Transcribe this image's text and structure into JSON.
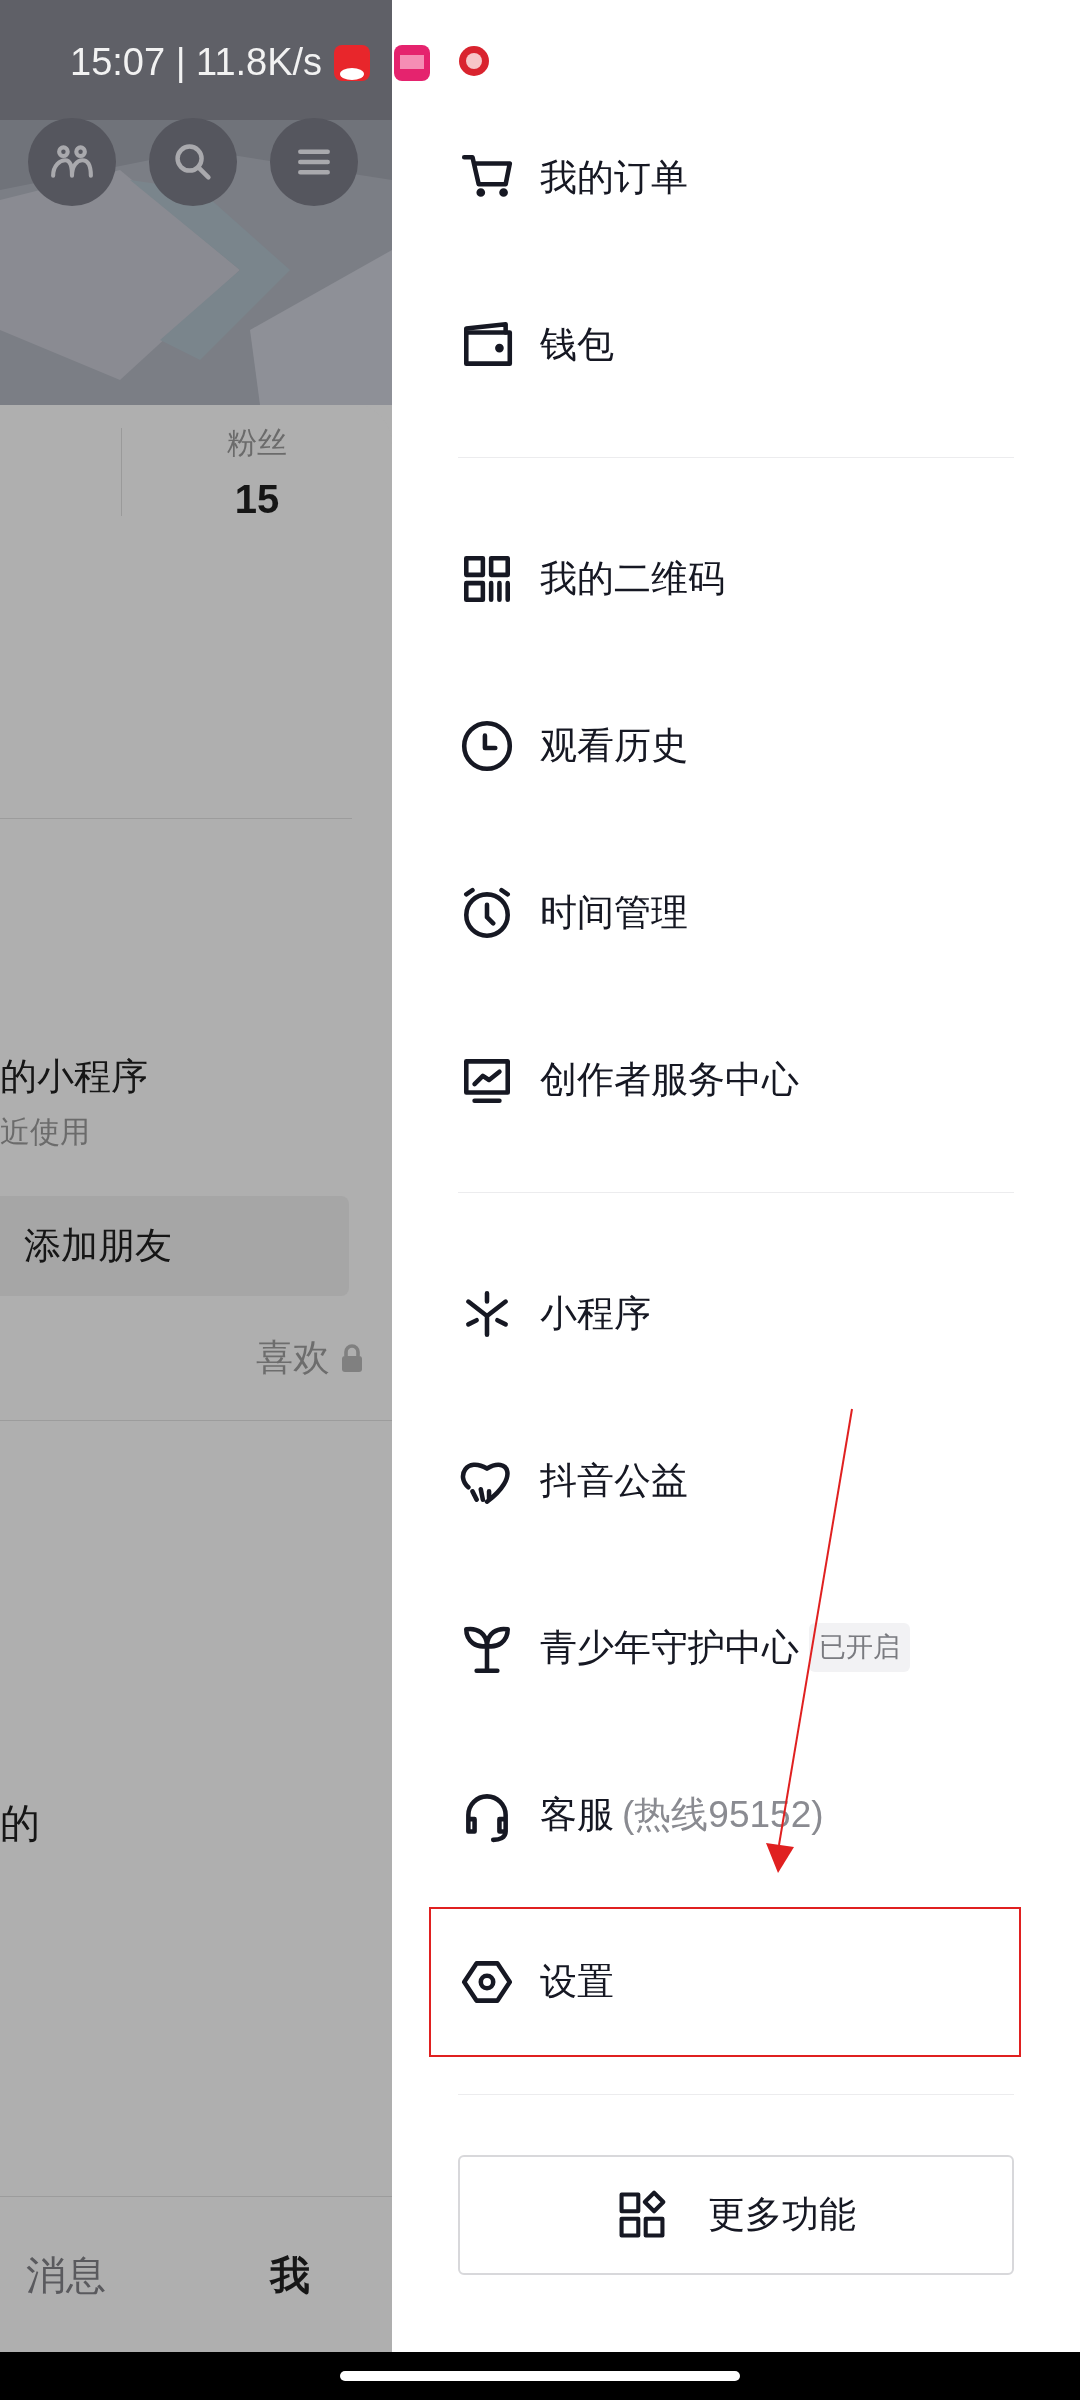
{
  "status_bar": {
    "text": "15:07 | 11.8K/s"
  },
  "profile": {
    "stats": [
      {
        "label": "粉丝",
        "value": "15"
      }
    ],
    "mini_programs": {
      "title": "的小程序",
      "subtitle": "近使用"
    },
    "add_friend_button": "添加朋友",
    "content_tabs": [
      {
        "label": "喜欢",
        "locked": true
      }
    ],
    "section_title": "的"
  },
  "bottom_nav": [
    {
      "label": "消息",
      "selected": false
    },
    {
      "label": "我",
      "selected": true
    }
  ],
  "drawer": {
    "groups": [
      {
        "items": [
          {
            "label": "我的订单",
            "highlighted": false
          },
          {
            "label": "钱包",
            "highlighted": false
          }
        ]
      },
      {
        "items": [
          {
            "label": "我的二维码",
            "highlighted": false
          },
          {
            "label": "观看历史",
            "highlighted": false
          },
          {
            "label": "时间管理",
            "highlighted": false
          },
          {
            "label": "创作者服务中心",
            "highlighted": false
          }
        ]
      },
      {
        "items": [
          {
            "label": "小程序",
            "highlighted": false
          },
          {
            "label": "抖音公益",
            "highlighted": false
          },
          {
            "label": "青少年守护中心",
            "badge": "已开启",
            "highlighted": false
          },
          {
            "label": "客服",
            "note": "(热线95152)",
            "highlighted": false
          },
          {
            "label": "设置",
            "highlighted": true
          }
        ]
      }
    ],
    "more_button": "更多功能"
  }
}
